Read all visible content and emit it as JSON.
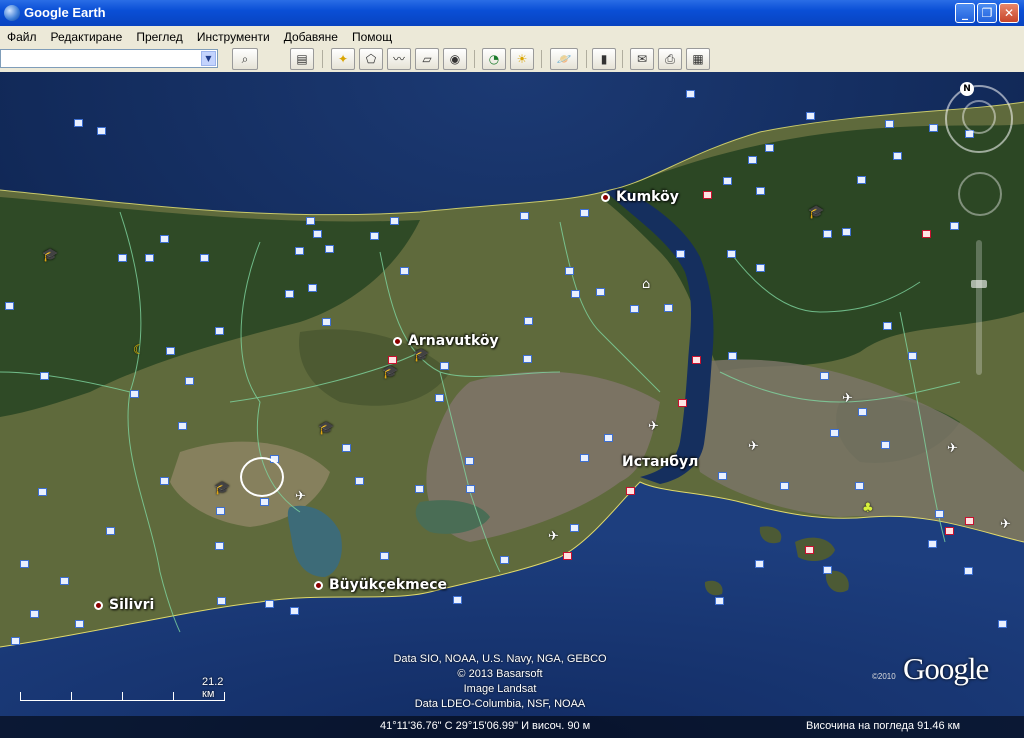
{
  "window": {
    "title": "Google Earth",
    "minimize": "_",
    "maximize": "❐",
    "close": "✕"
  },
  "menu": [
    "Файл",
    "Редактиране",
    "Преглед",
    "Инструменти",
    "Добавяне",
    "Помощ"
  ],
  "toolbar": {
    "search_value": "",
    "icons": [
      "search-icon",
      "sidebar-icon",
      "placemark-icon",
      "polygon-icon",
      "path-icon",
      "overlay-icon",
      "tour-icon",
      "historical-imagery-icon",
      "sunlight-icon",
      "planets-icon",
      "ruler-icon",
      "email-icon",
      "print-icon",
      "google-maps-icon"
    ]
  },
  "map": {
    "cities": [
      {
        "name": "Kumköy"
      },
      {
        "name": "Arnavutköy"
      },
      {
        "name": "Истанбул"
      },
      {
        "name": "Büyükçekmece"
      },
      {
        "name": "Silivri"
      }
    ],
    "credits": [
      "Data SIO, NOAA, U.S. Navy, NGA, GEBCO",
      "© 2013 Basarsoft",
      "Image Landsat",
      "Data LDEO-Columbia, NSF, NOAA"
    ],
    "google_logo": "Google",
    "logo_year": "©2010",
    "scale_label": "21.2 км",
    "compass_north": "N"
  },
  "status": {
    "coordinates": "41°11'36.76\" С   29°15'06.99\" И  височ.   90 м",
    "eye_altitude": "Височина на погледа    91.46 км"
  }
}
